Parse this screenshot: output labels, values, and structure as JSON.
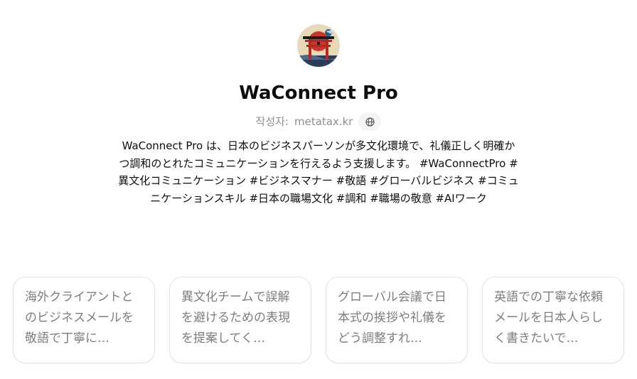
{
  "gpt": {
    "title": "WaConnect Pro",
    "author_label": "작성자:",
    "author_name": "metatax.kr",
    "description": "WaConnect Pro は、日本のビジネスパーソンが多文化環境で、礼儀正しく明確かつ調和のとれたコミュニケーションを行えるよう支援します。 #WaConnectPro #異文化コミュニケーション #ビジネスマナー #敬語 #グローバルビジネス #コミュニケーションスキル #日本の職場文化 #調和 #職場の敬意 #AIワーク"
  },
  "icons": {
    "avatar": "torii-gate-avatar",
    "website": "globe-icon"
  },
  "starters": [
    {
      "text": "海外クライアントとのビジネスメールを敬語で丁寧に…"
    },
    {
      "text": "異文化チームで誤解を避けるための表現を提案してく…"
    },
    {
      "text": "グローバル会議で日本式の挨拶や礼儀をどう調整すれ…"
    },
    {
      "text": "英語での丁寧な依頼メールを日本人らしく書きたいで…"
    }
  ]
}
